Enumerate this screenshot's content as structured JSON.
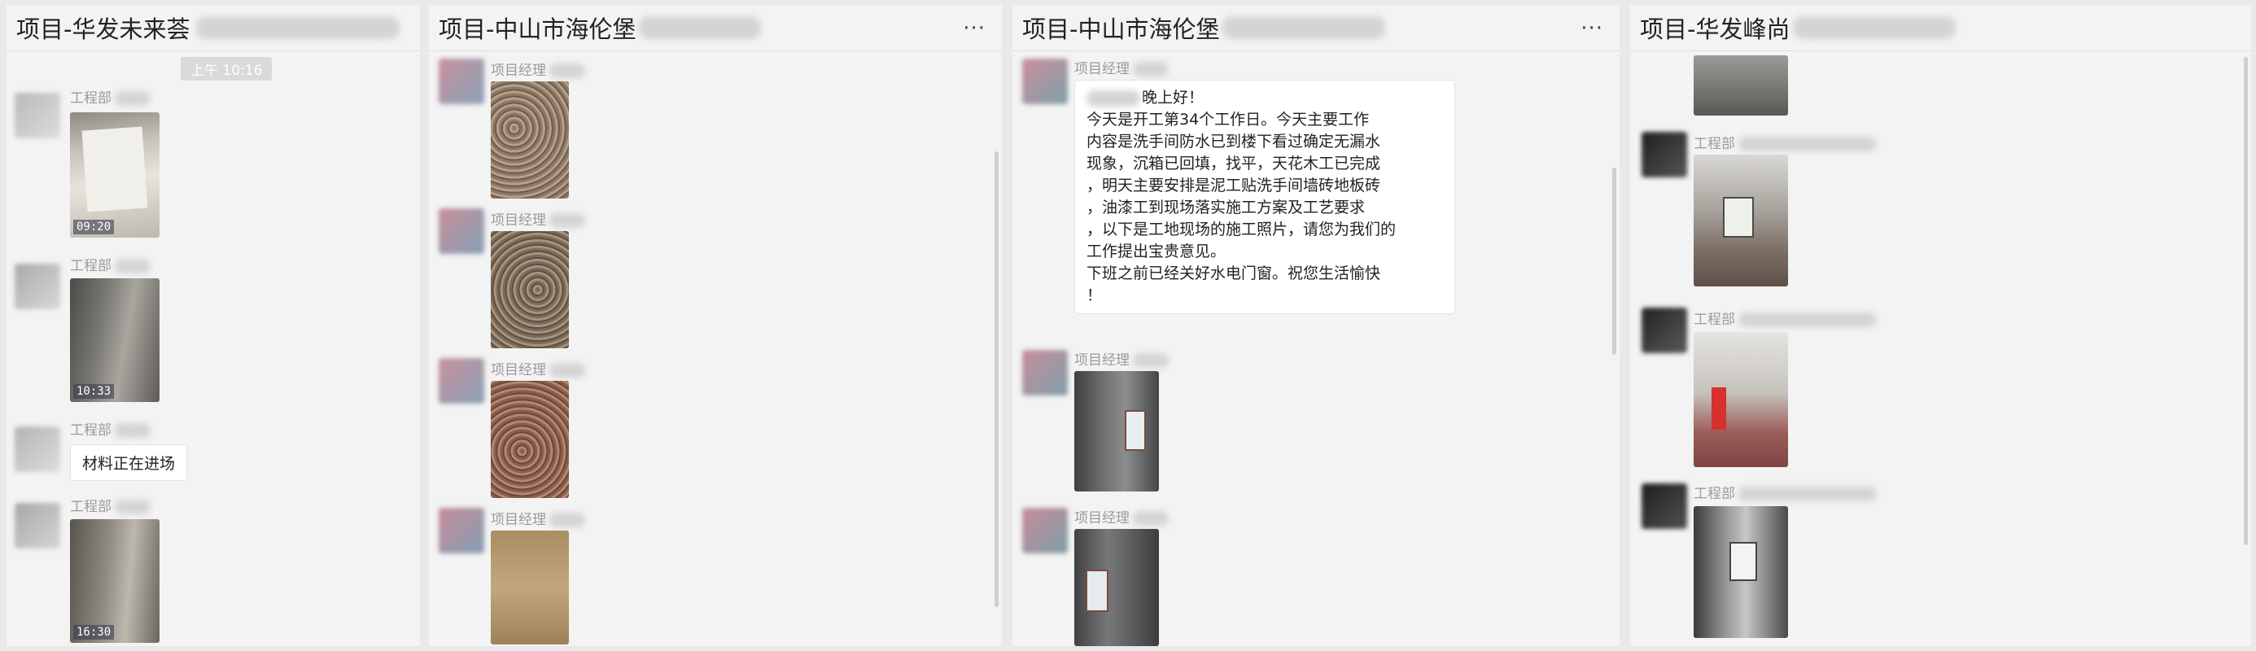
{
  "panels": [
    {
      "title": "项目-华发未来荟",
      "time": "上午 10:16",
      "messages": [
        {
          "sender": "工程部",
          "type": "image",
          "stamp": "09:20"
        },
        {
          "sender": "工程部",
          "type": "image",
          "stamp": "10:33"
        },
        {
          "sender": "工程部",
          "type": "text",
          "text": "材料正在进场"
        },
        {
          "sender": "工程部",
          "type": "image",
          "stamp": "16:30"
        }
      ]
    },
    {
      "title": "项目-中山市海伦堡",
      "more_label": "···",
      "messages": [
        {
          "sender": "项目经理",
          "type": "image"
        },
        {
          "sender": "项目经理",
          "type": "image"
        },
        {
          "sender": "项目经理",
          "type": "image"
        },
        {
          "sender": "项目经理",
          "type": "image"
        }
      ]
    },
    {
      "title": "项目-中山市海伦堡",
      "more_label": "···",
      "messages": [
        {
          "sender": "项目经理",
          "type": "text",
          "text": "晚上好！\n今天是开工第34个工作日。今天主要工作\n内容是洗手间防水已到楼下看过确定无漏水\n现象，沉箱已回填，找平，天花木工已完成\n，明天主要安排是泥工贴洗手间墙砖地板砖\n，油漆工到现场落实施工方案及工艺要求\n，以下是工地现场的施工照片，请您为我们的\n工作提出宝贵意见。\n下班之前已经关好水电门窗。祝您生活愉快\n！"
        },
        {
          "sender": "项目经理",
          "type": "image"
        },
        {
          "sender": "项目经理",
          "type": "image"
        }
      ]
    },
    {
      "title": "项目-华发峰尚",
      "messages": [
        {
          "sender": "工程部",
          "type": "image"
        },
        {
          "sender": "工程部",
          "type": "image"
        },
        {
          "sender": "工程部",
          "type": "image"
        }
      ]
    }
  ]
}
